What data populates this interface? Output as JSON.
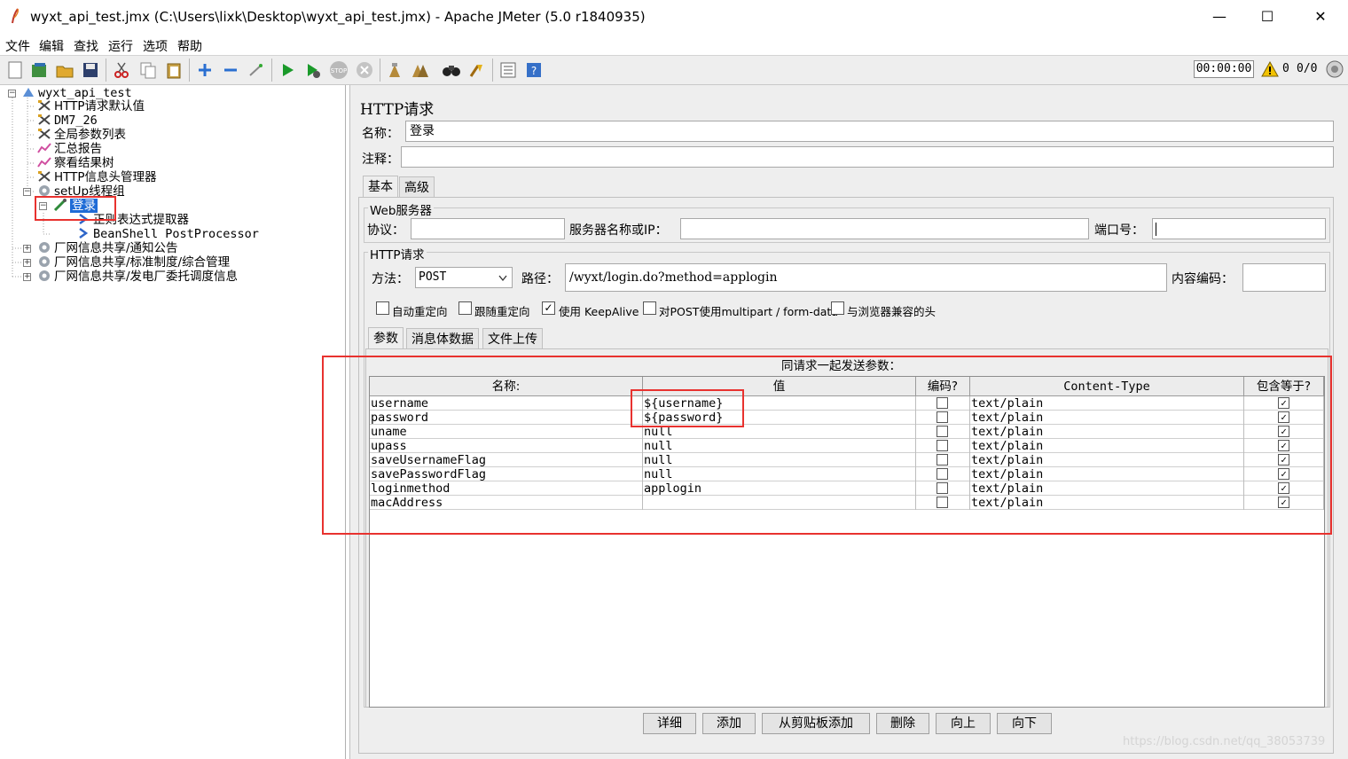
{
  "window": {
    "title": "wyxt_api_test.jmx (C:\\Users\\lixk\\Desktop\\wyxt_api_test.jmx) - Apache JMeter (5.0 r1840935)",
    "minimize": "—",
    "maximize": "☐",
    "close": "✕"
  },
  "menu": [
    "文件",
    "编辑",
    "查找",
    "运行",
    "选项",
    "帮助"
  ],
  "toolbar": {
    "timer": "00:00:00",
    "warn_count": "0",
    "thread_count": "0/0"
  },
  "tree": {
    "root": "wyxt_api_test",
    "items": [
      "HTTP请求默认值",
      "DM7_26",
      "全局参数列表",
      "汇总报告",
      "察看结果树",
      "HTTP信息头管理器",
      "setUp线程组"
    ],
    "selected": "登录",
    "children": [
      "正则表达式提取器",
      "BeanShell PostProcessor"
    ],
    "groups": [
      "厂网信息共享/通知公告",
      "厂网信息共享/标准制度/综合管理",
      "厂网信息共享/发电厂委托调度信息"
    ]
  },
  "panel": {
    "heading": "HTTP请求",
    "name_label": "名称：",
    "name_value": "登录",
    "comment_label": "注释：",
    "tabs": [
      "基本",
      "高级"
    ],
    "web_server": "Web服务器",
    "protocol_label": "协议：",
    "server_label": "服务器名称或IP：",
    "port_label": "端口号：",
    "http_request": "HTTP请求",
    "method_label": "方法：",
    "method_value": "POST",
    "path_label": "路径：",
    "path_value": "/wyxt/login.do?method=applogin",
    "encoding_label": "内容编码：",
    "checkboxes": [
      {
        "label": "自动重定向",
        "checked": false
      },
      {
        "label": "跟随重定向",
        "checked": false
      },
      {
        "label": "使用 KeepAlive",
        "checked": true
      },
      {
        "label": "对POST使用multipart / form-data",
        "checked": false
      },
      {
        "label": "与浏览器兼容的头",
        "checked": false
      }
    ],
    "subtabs": [
      "参数",
      "消息体数据",
      "文件上传"
    ],
    "params_caption": "同请求一起发送参数："
  },
  "table": {
    "headers": [
      "名称:",
      "值",
      "编码?",
      "Content-Type",
      "包含等于?"
    ],
    "rows": [
      {
        "name": "username",
        "value": "${username}",
        "content_type": "text/plain"
      },
      {
        "name": "password",
        "value": "${password}",
        "content_type": "text/plain"
      },
      {
        "name": "uname",
        "value": "null",
        "content_type": "text/plain"
      },
      {
        "name": "upass",
        "value": "null",
        "content_type": "text/plain"
      },
      {
        "name": "saveUsernameFlag",
        "value": "null",
        "content_type": "text/plain"
      },
      {
        "name": "savePasswordFlag",
        "value": "null",
        "content_type": "text/plain"
      },
      {
        "name": "loginmethod",
        "value": "applogin",
        "content_type": "text/plain"
      },
      {
        "name": "macAddress",
        "value": "",
        "content_type": "text/plain"
      }
    ]
  },
  "buttons": [
    "详细",
    "添加",
    "从剪贴板添加",
    "删除",
    "向上",
    "向下"
  ],
  "watermark": "https://blog.csdn.net/qq_38053739",
  "colors": {
    "accent_red": "#e8322f",
    "selection": "#1e6bd6",
    "run_green": "#1a9a2a"
  }
}
